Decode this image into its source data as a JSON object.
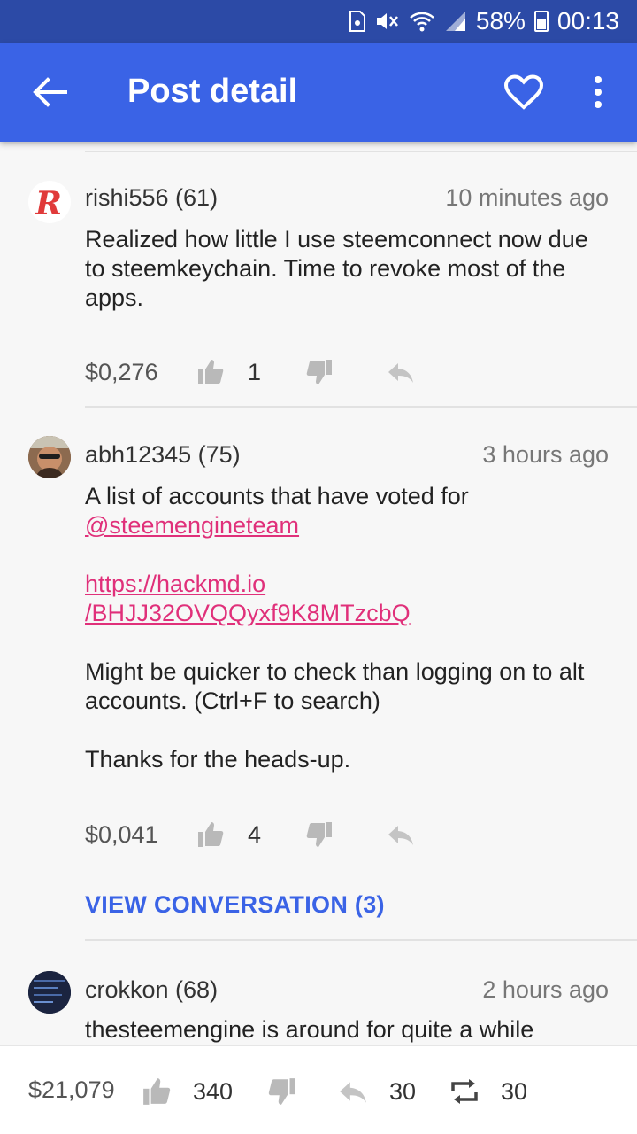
{
  "status_bar": {
    "battery": "58%",
    "time": "00:13",
    "icons": [
      "sim-icon",
      "mute-icon",
      "wifi-icon",
      "signal-icon",
      "battery-icon"
    ]
  },
  "app_bar": {
    "title": "Post detail",
    "icons": [
      "back-arrow-icon",
      "heart-icon",
      "more-vert-icon"
    ]
  },
  "comments": [
    {
      "author": "rishi556 (61)",
      "time": "10 minutes ago",
      "body_lines": [
        "Realized how little I use steemconnect now due",
        "to steemkeychain. Time to revoke most of the",
        "apps."
      ],
      "payout": "$0,276",
      "upvotes": "1"
    },
    {
      "author": "abh12345 (75)",
      "time": "3 hours ago",
      "body": {
        "line1": "A list of accounts that have voted for",
        "mention": "@steemengineteam",
        "url_line1": "https://hackmd.io",
        "url_line2": "/BHJJ32OVQQyxf9K8MTzcbQ",
        "para2_line1": "Might be quicker to check than logging on to alt",
        "para2_line2": "accounts. (Ctrl+F to search)",
        "para3": "Thanks for the heads-up."
      },
      "payout": "$0,041",
      "upvotes": "4",
      "view_conversation": "VIEW CONVERSATION (3)"
    },
    {
      "author": "crokkon (68)",
      "time": "2 hours ago",
      "body_line": "thesteemengine is around for quite a while"
    }
  ],
  "bottom_bar": {
    "payout": "$21,079",
    "upvotes": "340",
    "replies": "30",
    "resteems": "30"
  },
  "colors": {
    "status_bar": "#2c4aa6",
    "app_bar": "#3a63e6",
    "link": "#e0307a",
    "accent": "#3a63e6"
  }
}
